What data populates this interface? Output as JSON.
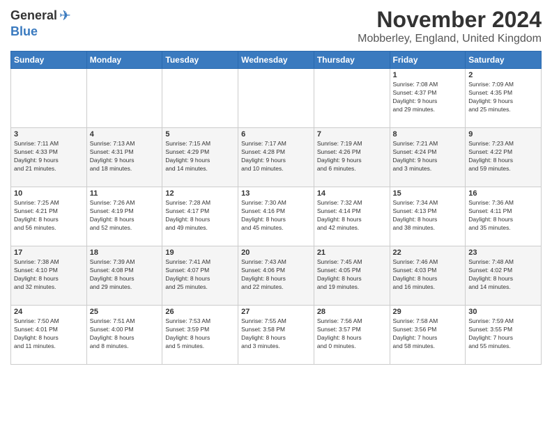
{
  "header": {
    "logo": {
      "general": "General",
      "blue": "Blue",
      "tagline": ""
    },
    "title": "November 2024",
    "subtitle": "Mobberley, England, United Kingdom"
  },
  "calendar": {
    "weekdays": [
      "Sunday",
      "Monday",
      "Tuesday",
      "Wednesday",
      "Thursday",
      "Friday",
      "Saturday"
    ],
    "weeks": [
      {
        "days": [
          {
            "num": "",
            "info": ""
          },
          {
            "num": "",
            "info": ""
          },
          {
            "num": "",
            "info": ""
          },
          {
            "num": "",
            "info": ""
          },
          {
            "num": "",
            "info": ""
          },
          {
            "num": "1",
            "info": "Sunrise: 7:08 AM\nSunset: 4:37 PM\nDaylight: 9 hours\nand 29 minutes."
          },
          {
            "num": "2",
            "info": "Sunrise: 7:09 AM\nSunset: 4:35 PM\nDaylight: 9 hours\nand 25 minutes."
          }
        ]
      },
      {
        "days": [
          {
            "num": "3",
            "info": "Sunrise: 7:11 AM\nSunset: 4:33 PM\nDaylight: 9 hours\nand 21 minutes."
          },
          {
            "num": "4",
            "info": "Sunrise: 7:13 AM\nSunset: 4:31 PM\nDaylight: 9 hours\nand 18 minutes."
          },
          {
            "num": "5",
            "info": "Sunrise: 7:15 AM\nSunset: 4:29 PM\nDaylight: 9 hours\nand 14 minutes."
          },
          {
            "num": "6",
            "info": "Sunrise: 7:17 AM\nSunset: 4:28 PM\nDaylight: 9 hours\nand 10 minutes."
          },
          {
            "num": "7",
            "info": "Sunrise: 7:19 AM\nSunset: 4:26 PM\nDaylight: 9 hours\nand 6 minutes."
          },
          {
            "num": "8",
            "info": "Sunrise: 7:21 AM\nSunset: 4:24 PM\nDaylight: 9 hours\nand 3 minutes."
          },
          {
            "num": "9",
            "info": "Sunrise: 7:23 AM\nSunset: 4:22 PM\nDaylight: 8 hours\nand 59 minutes."
          }
        ]
      },
      {
        "days": [
          {
            "num": "10",
            "info": "Sunrise: 7:25 AM\nSunset: 4:21 PM\nDaylight: 8 hours\nand 56 minutes."
          },
          {
            "num": "11",
            "info": "Sunrise: 7:26 AM\nSunset: 4:19 PM\nDaylight: 8 hours\nand 52 minutes."
          },
          {
            "num": "12",
            "info": "Sunrise: 7:28 AM\nSunset: 4:17 PM\nDaylight: 8 hours\nand 49 minutes."
          },
          {
            "num": "13",
            "info": "Sunrise: 7:30 AM\nSunset: 4:16 PM\nDaylight: 8 hours\nand 45 minutes."
          },
          {
            "num": "14",
            "info": "Sunrise: 7:32 AM\nSunset: 4:14 PM\nDaylight: 8 hours\nand 42 minutes."
          },
          {
            "num": "15",
            "info": "Sunrise: 7:34 AM\nSunset: 4:13 PM\nDaylight: 8 hours\nand 38 minutes."
          },
          {
            "num": "16",
            "info": "Sunrise: 7:36 AM\nSunset: 4:11 PM\nDaylight: 8 hours\nand 35 minutes."
          }
        ]
      },
      {
        "days": [
          {
            "num": "17",
            "info": "Sunrise: 7:38 AM\nSunset: 4:10 PM\nDaylight: 8 hours\nand 32 minutes."
          },
          {
            "num": "18",
            "info": "Sunrise: 7:39 AM\nSunset: 4:08 PM\nDaylight: 8 hours\nand 29 minutes."
          },
          {
            "num": "19",
            "info": "Sunrise: 7:41 AM\nSunset: 4:07 PM\nDaylight: 8 hours\nand 25 minutes."
          },
          {
            "num": "20",
            "info": "Sunrise: 7:43 AM\nSunset: 4:06 PM\nDaylight: 8 hours\nand 22 minutes."
          },
          {
            "num": "21",
            "info": "Sunrise: 7:45 AM\nSunset: 4:05 PM\nDaylight: 8 hours\nand 19 minutes."
          },
          {
            "num": "22",
            "info": "Sunrise: 7:46 AM\nSunset: 4:03 PM\nDaylight: 8 hours\nand 16 minutes."
          },
          {
            "num": "23",
            "info": "Sunrise: 7:48 AM\nSunset: 4:02 PM\nDaylight: 8 hours\nand 14 minutes."
          }
        ]
      },
      {
        "days": [
          {
            "num": "24",
            "info": "Sunrise: 7:50 AM\nSunset: 4:01 PM\nDaylight: 8 hours\nand 11 minutes."
          },
          {
            "num": "25",
            "info": "Sunrise: 7:51 AM\nSunset: 4:00 PM\nDaylight: 8 hours\nand 8 minutes."
          },
          {
            "num": "26",
            "info": "Sunrise: 7:53 AM\nSunset: 3:59 PM\nDaylight: 8 hours\nand 5 minutes."
          },
          {
            "num": "27",
            "info": "Sunrise: 7:55 AM\nSunset: 3:58 PM\nDaylight: 8 hours\nand 3 minutes."
          },
          {
            "num": "28",
            "info": "Sunrise: 7:56 AM\nSunset: 3:57 PM\nDaylight: 8 hours\nand 0 minutes."
          },
          {
            "num": "29",
            "info": "Sunrise: 7:58 AM\nSunset: 3:56 PM\nDaylight: 7 hours\nand 58 minutes."
          },
          {
            "num": "30",
            "info": "Sunrise: 7:59 AM\nSunset: 3:55 PM\nDaylight: 7 hours\nand 55 minutes."
          }
        ]
      }
    ]
  }
}
